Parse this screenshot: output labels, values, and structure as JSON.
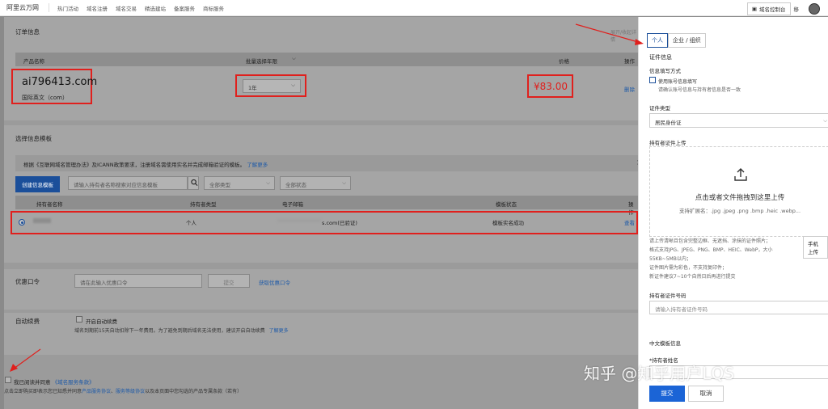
{
  "topnav": {
    "logo": "阿里云万网",
    "links": [
      "热门活动",
      "域名注册",
      "域名交易",
      "精选建站",
      "备案服务",
      "商标服务"
    ],
    "console_label": "域名控制台",
    "right_partial": "移"
  },
  "order": {
    "section_title": "订单信息",
    "right_hint": "展开/收起详情",
    "columns": [
      "产品名称",
      "批量选择年限",
      "价格",
      "操作"
    ],
    "domain": "ai796413.com",
    "domain_sub": "国际英文（com）",
    "year": "1年",
    "price": "¥83.00",
    "delete_label": "删除"
  },
  "template": {
    "section_title": "选择信息模板",
    "notice": "根据《互联网域名管理办法》及ICANN政策要求，注册域名需使用实名并完成邮箱验证的模板。",
    "notice_link": "了解更多",
    "create_btn": "创建信息模板",
    "search_placeholder": "请输入持有者名称搜索对应信息模板",
    "filter_type": "全部类型",
    "filter_status": "全部状态",
    "columns": [
      "持有者名称",
      "持有者类型",
      "电子邮箱",
      "模板状态",
      "操作"
    ],
    "row": {
      "type": "个人",
      "email": "s.com(已验证)",
      "status": "模板实名成功",
      "action": "查看"
    }
  },
  "coupon": {
    "label": "优惠口令",
    "placeholder": "请在此输入优惠口令",
    "use_btn": "提交",
    "get_link": "获取优惠口令"
  },
  "autorenew": {
    "label": "自动续费",
    "checkbox_label": "开启自动续费",
    "desc": "域名到期前15天自动扣除下一年费用。为了避免到期后域名无法使用，建议开启自动续费",
    "link": "了解更多"
  },
  "agreement": {
    "checkbox_label": "我已阅读并同意",
    "terms_link": "《域名服务条款》",
    "footer_prefix": "点击立即购买即表示您已知悉并同意",
    "footer_link1": "产品服务协议",
    "footer_sep": "、",
    "footer_link2": "服务等级协议",
    "footer_suffix": "以及本页面中您勾选的产品专属条款（若有）"
  },
  "drawer": {
    "tabs": [
      "个人",
      "企业 / 组织"
    ],
    "cert_info": "证件信息",
    "fill_method": "信息填写方式",
    "use_template_label": "使用账号信息填写",
    "use_template_hint": "请确认账号信息与持有者信息是否一致",
    "cert_type_label": "证件类型",
    "cert_type_value": "居民身份证",
    "upload_label": "持有者证件上传",
    "upload_title": "点击或者文件拖拽到这里上传",
    "upload_hint": "支持扩展名：.jpg .jpeg .png .bmp .heic .webp...",
    "phone_upload": "手机上传",
    "rules": [
      "请上传清晰且包含完整边框、无遮挡、涂抹的证件照片；",
      "格式支持JPG、JPEG、PNG、BMP、HEIC、WebP，大小",
      "55KB~5MB以内；",
      "证件图片需为彩色，不支持复印件；",
      "新证件建议7~10个自然日后再进行提交"
    ],
    "cert_no_label": "持有者证件号码",
    "cert_no_placeholder": "请输入持有者证件号码",
    "cn_template_label": "中文模板信息",
    "holder_name_label": "*持有者姓名",
    "submit": "提交",
    "cancel": "取消"
  },
  "watermark": "知乎 @知乎用户LQS",
  "colors": {
    "annotation_red": "#e0201d",
    "primary_blue": "#1b64d6",
    "link_blue": "#1e5aa8"
  }
}
